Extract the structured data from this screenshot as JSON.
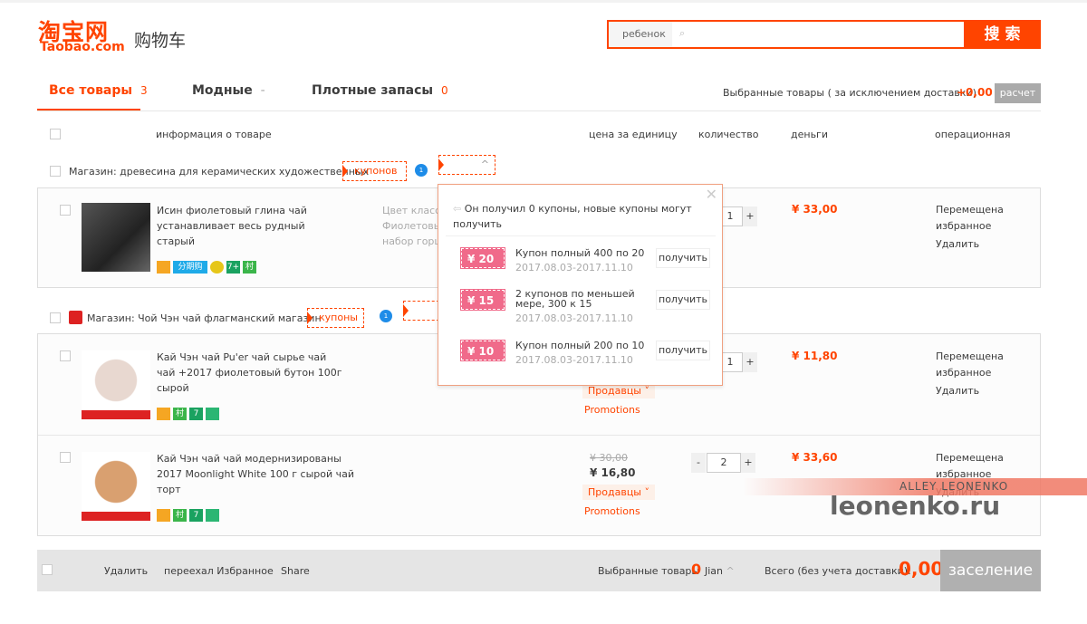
{
  "header": {
    "logo_cn": "淘宝网",
    "logo_en": "Taobao.com",
    "title": "购物车",
    "search_scope": "ребенок",
    "search_placeholder": "",
    "search_button": "搜 索"
  },
  "tabs": [
    {
      "label": "Все товары",
      "count": "3",
      "active": true
    },
    {
      "label": "Модные",
      "count": "-"
    },
    {
      "label": "Плотные запасы",
      "count": "0"
    }
  ],
  "summary": {
    "label": "Выбранные товары ( за исключением доставки)",
    "amount": "+0,00",
    "button": "расчет"
  },
  "columns": {
    "info": "информация о товаре",
    "unit_price": "цена за единицу",
    "qty": "количество",
    "money": "деньги",
    "ops": "операционная"
  },
  "stores": [
    {
      "name": "Магазин: древесина для керамических художественных",
      "coupon": "купонов",
      "badge": "1",
      "items": [
        {
          "title": "Исин фиолетовый глина чай устанавливает весь рудный старый",
          "attrs": [
            "Цвет класси",
            "Фиолетовый",
            "набор горш"
          ],
          "qty": "1",
          "total": "¥ 33,00",
          "ops": [
            "Перемещена",
            "избранное",
            "Удалить"
          ],
          "icons": [
            "card",
            "分期购",
            "bulb",
            "7+",
            "村"
          ]
        }
      ]
    },
    {
      "name": "Магазин: Чой Чэн чай флагманский магазин",
      "coupon": "купоны",
      "badge": "1",
      "items": [
        {
          "title": "Кай Чэн чай Pu'er чай сырье чай чай +2017 фиолетовый бутон 100г сырой",
          "qty": "1",
          "total": "¥ 11,80",
          "seller": "Продавцы",
          "promo": "Promotions",
          "ops": [
            "Перемещена",
            "избранное",
            "Удалить"
          ],
          "icons": [
            "card",
            "村",
            "7",
            "bulb"
          ]
        },
        {
          "title": "Кай Чэн чай чай модернизированы 2017 Moonlight White 100 г сырой чай торт",
          "old_price": "¥ 30,00",
          "price": "¥ 16,80",
          "qty": "2",
          "total": "¥ 33,60",
          "seller": "Продавцы",
          "promo": "Promotions",
          "ops": [
            "Перемещена",
            "избранное",
            "Удалить"
          ],
          "icons": [
            "card",
            "村",
            "7",
            "bulb"
          ]
        }
      ]
    }
  ],
  "popup": {
    "message": "Он получил 0 купоны, новые купоны могут получить",
    "coupons": [
      {
        "value": "¥ 20",
        "desc": "Купон полный 400 по 20",
        "dates": "2017.08.03-2017.11.10",
        "button": "получить"
      },
      {
        "value": "¥ 15",
        "desc": "2 купонов по меньшей мере, 300 к 15",
        "dates": "2017.08.03-2017.11.10",
        "button": "получить"
      },
      {
        "value": "¥ 10",
        "desc": "Купон полный 200 по 10",
        "dates": "2017.08.03-2017.11.10",
        "button": "получить"
      }
    ]
  },
  "footer": {
    "delete": "Удалить",
    "move_fav": "переехал Избранное",
    "share": "Share",
    "selected_label": "Выбранные товары",
    "selected_count": "0",
    "unit": "Jian",
    "total_label": "Всего (без учета доставки):",
    "total": "0,00",
    "checkout": "заселение"
  },
  "watermark": {
    "small": "ALLEY LEONENKO",
    "big": "leonenko.ru"
  },
  "colors": {
    "accent": "#ff4400",
    "coupon": "#f06a8a"
  }
}
